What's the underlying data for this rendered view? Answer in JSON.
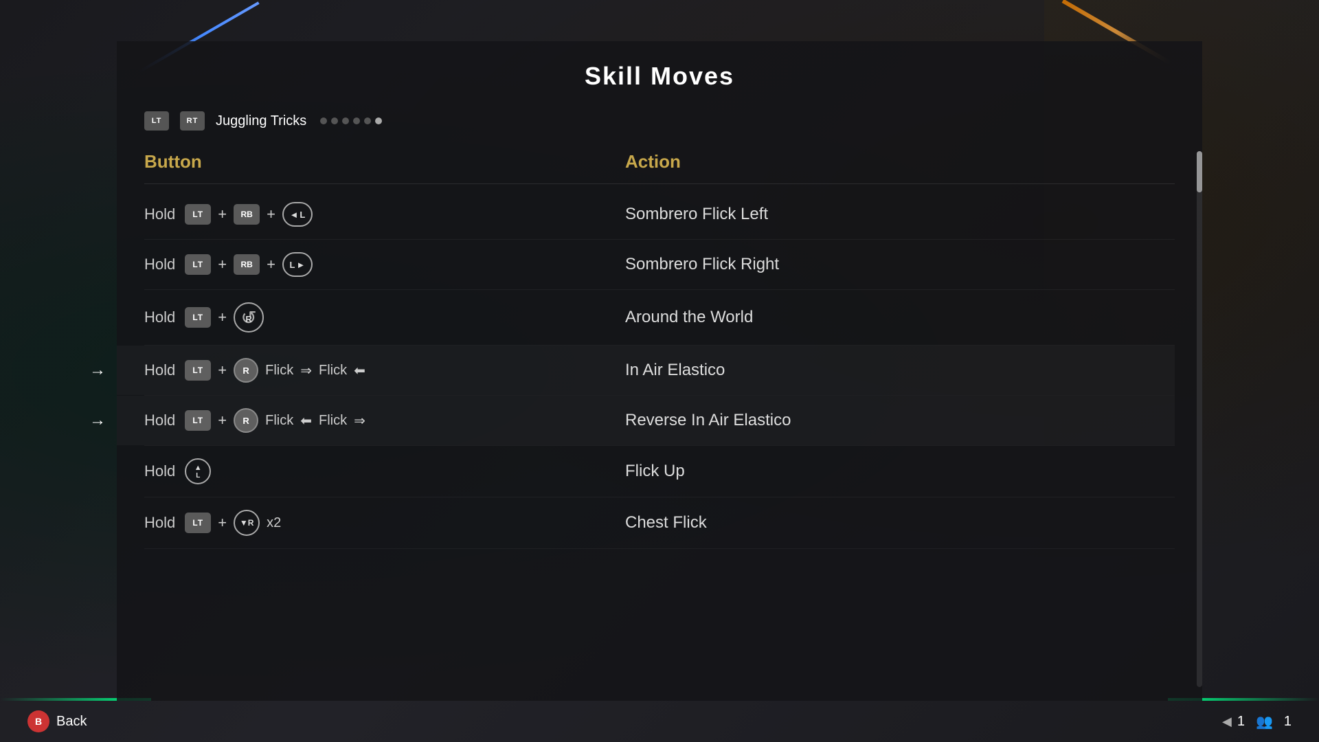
{
  "page": {
    "title": "Skill Moves",
    "category": {
      "lt_label": "LT",
      "rt_label": "RT",
      "name": "Juggling Tricks",
      "dots": [
        {
          "active": false
        },
        {
          "active": false
        },
        {
          "active": false
        },
        {
          "active": false
        },
        {
          "active": false
        },
        {
          "active": true
        }
      ]
    },
    "headers": {
      "button": "Button",
      "action": "Action"
    },
    "moves": [
      {
        "id": 1,
        "button_display": "Hold LT + RB + L←",
        "action": "Sombrero Flick Left",
        "highlighted": false,
        "type": "lt_rb_l_left"
      },
      {
        "id": 2,
        "button_display": "Hold LT + RB + L→",
        "action": "Sombrero Flick Right",
        "highlighted": false,
        "type": "lt_rb_l_right"
      },
      {
        "id": 3,
        "button_display": "Hold LT + R↺",
        "action": "Around the World",
        "highlighted": false,
        "type": "lt_r_rotate"
      },
      {
        "id": 4,
        "button_display": "Hold LT + R Flick → Flick ←",
        "action": "In Air Elastico",
        "highlighted": true,
        "type": "lt_r_flick_right_left"
      },
      {
        "id": 5,
        "button_display": "Hold LT + R Flick ← Flick →",
        "action": "Reverse In Air Elastico",
        "highlighted": true,
        "type": "lt_r_flick_left_right"
      },
      {
        "id": 6,
        "button_display": "Hold L↑",
        "action": "Flick Up",
        "highlighted": false,
        "type": "l_up"
      },
      {
        "id": 7,
        "button_display": "Hold LT + R↓ x2",
        "action": "Chest Flick",
        "highlighted": false,
        "type": "lt_r_down_x2"
      }
    ],
    "bottom": {
      "back_btn_label": "B",
      "back_label": "Back",
      "page_number": "1",
      "players": "1"
    }
  }
}
